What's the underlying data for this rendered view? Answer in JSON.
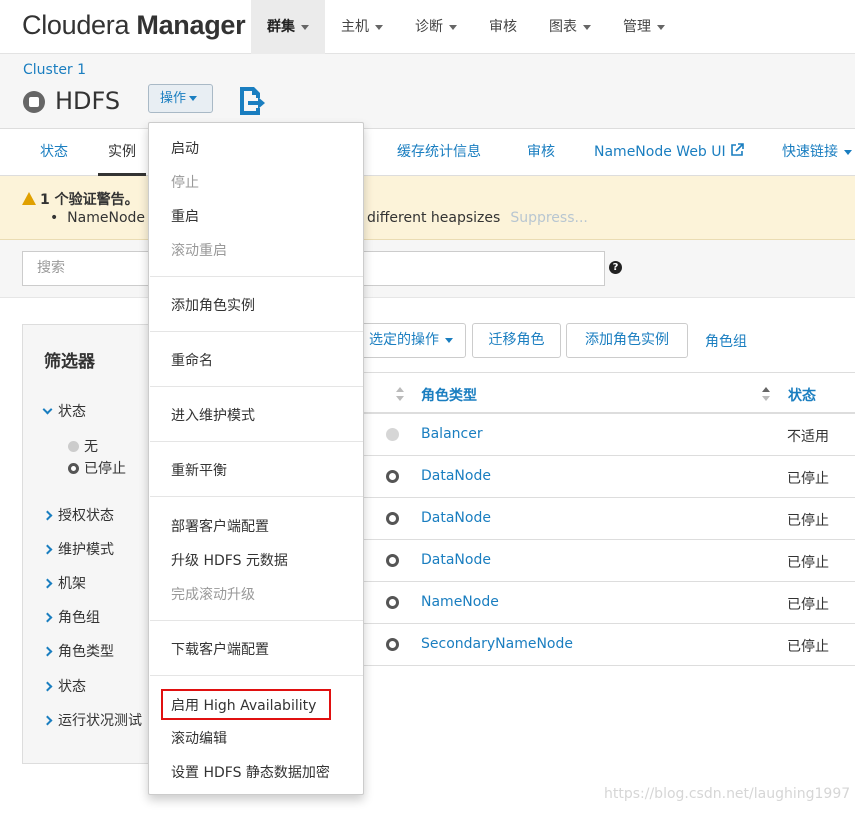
{
  "app": {
    "logo_light": "Cloudera ",
    "logo_bold": "Manager"
  },
  "nav": [
    {
      "label": "群集",
      "active": true
    },
    {
      "label": "主机"
    },
    {
      "label": "诊断"
    },
    {
      "label": "审核",
      "no_caret": true
    },
    {
      "label": "图表"
    },
    {
      "label": "管理"
    }
  ],
  "service": {
    "cluster": "Cluster 1",
    "name": "HDFS",
    "actions_label": "操作"
  },
  "tabs": [
    {
      "label": "状态"
    },
    {
      "label": "实例",
      "active": true
    },
    {
      "label": "缓存统计信息"
    },
    {
      "label": "审核"
    },
    {
      "label": "NameNode Web UI"
    },
    {
      "label": "快速链接"
    }
  ],
  "warning": {
    "title": "1 个验证警告。",
    "line_start": "NameNode",
    "line_end": "different heapsizes",
    "suppress": "Suppress..."
  },
  "search": {
    "placeholder": "搜索",
    "help": "?"
  },
  "filters": {
    "title": "筛选器",
    "status_label": "状态",
    "status_options": [
      "无",
      "已停止"
    ],
    "groups": [
      "授权状态",
      "维护模式",
      "机架",
      "角色组",
      "角色类型",
      "状态",
      "运行状况测试"
    ]
  },
  "actions": {
    "selected_ops": "选定的操作",
    "migrate": "迁移角色",
    "add_instance": "添加角色实例",
    "role_groups": "角色组"
  },
  "table": {
    "col_role_type": "角色类型",
    "col_state": "状态",
    "rows": [
      {
        "role": "Balancer",
        "state": "不适用",
        "icon": "grey"
      },
      {
        "role": "DataNode",
        "state": "已停止",
        "icon": "stopped"
      },
      {
        "role": "DataNode",
        "state": "已停止",
        "icon": "stopped"
      },
      {
        "role": "DataNode",
        "state": "已停止",
        "icon": "stopped"
      },
      {
        "role": "NameNode",
        "state": "已停止",
        "icon": "stopped"
      },
      {
        "role": "SecondaryNameNode",
        "state": "已停止",
        "icon": "stopped"
      }
    ]
  },
  "menu": {
    "items": [
      {
        "label": "启动"
      },
      {
        "label": "停止",
        "disabled": true
      },
      {
        "label": "重启"
      },
      {
        "label": "滚动重启",
        "disabled": true
      },
      {
        "label": "添加角色实例"
      },
      {
        "label": "重命名"
      },
      {
        "label": "进入维护模式"
      },
      {
        "label": "重新平衡"
      },
      {
        "label": "部署客户端配置"
      },
      {
        "label": "升级 HDFS 元数据"
      },
      {
        "label": "完成滚动升级",
        "disabled": true
      },
      {
        "label": "下载客户端配置"
      },
      {
        "label": "启用 High Availability",
        "highlighted": true
      },
      {
        "label": "滚动编辑"
      },
      {
        "label": "设置 HDFS 静态数据加密"
      }
    ]
  },
  "watermark": "https://blog.csdn.net/laughing1997",
  "colors": {
    "link": "#1a7ec0",
    "warning_bg": "#fcf3d9",
    "highlight_box": "#e01010"
  }
}
